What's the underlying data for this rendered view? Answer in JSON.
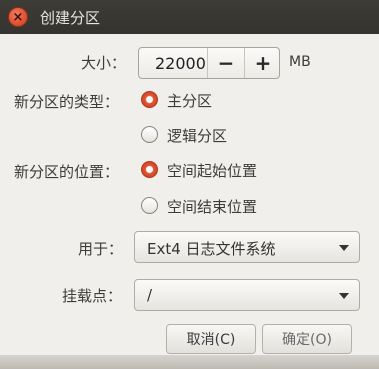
{
  "window": {
    "title": "创建分区",
    "close_glyph": "×"
  },
  "size": {
    "label": "大小：",
    "value": "22000",
    "minus": "−",
    "plus": "+",
    "unit": "MB"
  },
  "partition_type": {
    "label": "新分区的类型：",
    "options": [
      "主分区",
      "逻辑分区"
    ],
    "selected": 0
  },
  "partition_location": {
    "label": "新分区的位置：",
    "options": [
      "空间起始位置",
      "空间结束位置"
    ],
    "selected": 0
  },
  "use_as": {
    "label": "用于：",
    "value": "Ext4 日志文件系统"
  },
  "mount_point": {
    "label": "挂载点：",
    "value": "/"
  },
  "buttons": {
    "cancel": "取消(C)",
    "ok": "确定(O)"
  },
  "colors": {
    "titlebar": "#3a3934",
    "dialog_bg": "#f1efec",
    "accent": "#d9482a"
  }
}
